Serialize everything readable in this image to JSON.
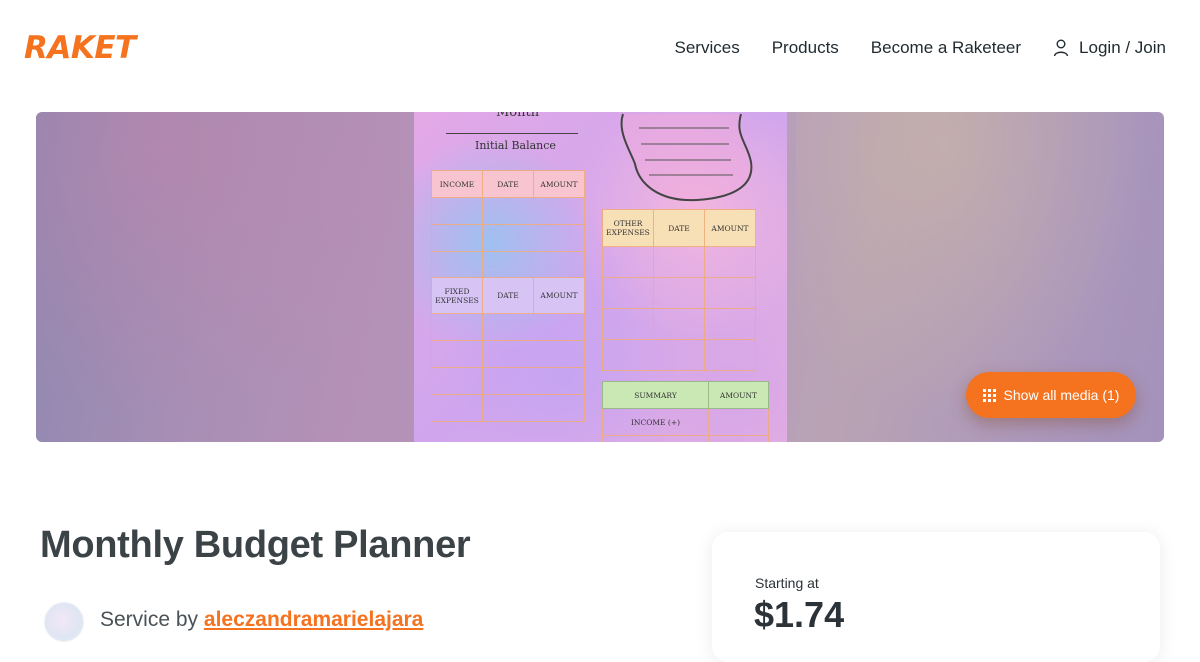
{
  "brand": {
    "logo_text": "RAKET",
    "accent": "#f5721f"
  },
  "nav": {
    "items": [
      "Services",
      "Products",
      "Become a Raketeer"
    ],
    "login_label": "Login / Join"
  },
  "hero": {
    "planner": {
      "month_label": "Month",
      "initial_balance_label": "Initial Balance",
      "income_table": {
        "headers": [
          "INCOME",
          "DATE",
          "AMOUNT"
        ]
      },
      "fixed_table": {
        "headers": [
          "FIXED EXPENSES",
          "DATE",
          "AMOUNT"
        ]
      },
      "other_table": {
        "headers": [
          "OTHER EXPENSES",
          "DATE",
          "AMOUNT"
        ]
      },
      "summary_table": {
        "headers": [
          "SUMMARY",
          "AMOUNT"
        ],
        "row1": "INCOME (+)"
      }
    },
    "show_media_label": "Show all media (1)"
  },
  "listing": {
    "title": "Monthly Budget Planner",
    "service_by_prefix": "Service by",
    "seller": "aleczandramarielajara"
  },
  "pricing": {
    "starting_label": "Starting at",
    "price": "$1.74"
  }
}
